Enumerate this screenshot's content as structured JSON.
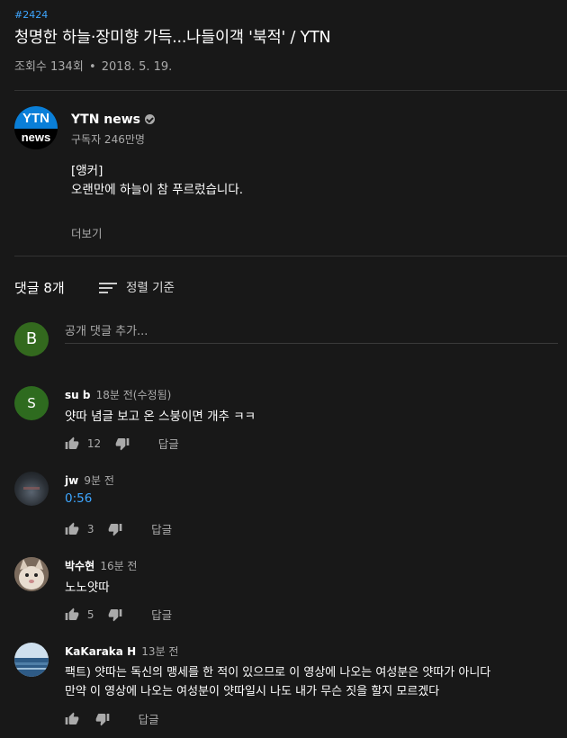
{
  "video": {
    "hashtag": "#2424",
    "title": "청명한 하늘·장미향 가득...나들이객 '북적' / YTN",
    "views": "조회수 134회",
    "date": "2018. 5. 19."
  },
  "channel": {
    "name": "YTN news",
    "subscribers": "구독자 246만명",
    "description_line1": "[앵커]",
    "description_line2": "오랜만에 하늘이 참 푸르렀습니다.",
    "more_label": "더보기",
    "avatar_text_top": "YTN",
    "avatar_text_bottom": "news"
  },
  "comments_header": {
    "count": "댓글 8개",
    "sort_label": "정렬 기준"
  },
  "add_comment": {
    "avatar_letter": "B",
    "placeholder": "공개 댓글 추가..."
  },
  "comments": [
    {
      "author": "su b",
      "time": "18분 전(수정됨)",
      "text": "얏따 념글 보고 온 스붕이면 개추 ㅋㅋ",
      "likes": "12",
      "reply_label": "답글",
      "avatar_letter": "S"
    },
    {
      "author": "jw",
      "time": "9분 전",
      "timestamp_link": "0:56",
      "likes": "3",
      "reply_label": "답글"
    },
    {
      "author": "박수현",
      "time": "16분 전",
      "text": "노노얏따",
      "likes": "5",
      "reply_label": "답글"
    },
    {
      "author": "KaKaraka H",
      "time": "13분 전",
      "text_line1": "팩트) 얏따는 독신의 맹세를 한 적이 있으므로 이 영상에 나오는 여성분은 얏따가 아니다",
      "text_line2": "만약 이 영상에 나오는 여성분이 얏따일시 나도 내가 무슨 짓을 할지 모르겠다",
      "likes": "",
      "reply_label": "답글"
    }
  ],
  "colors": {
    "background": "#181818",
    "link": "#3ea6ff",
    "secondary_text": "#aaaaaa",
    "avatar_green": "#33691e",
    "avatar_s": "#2e6b1f"
  }
}
